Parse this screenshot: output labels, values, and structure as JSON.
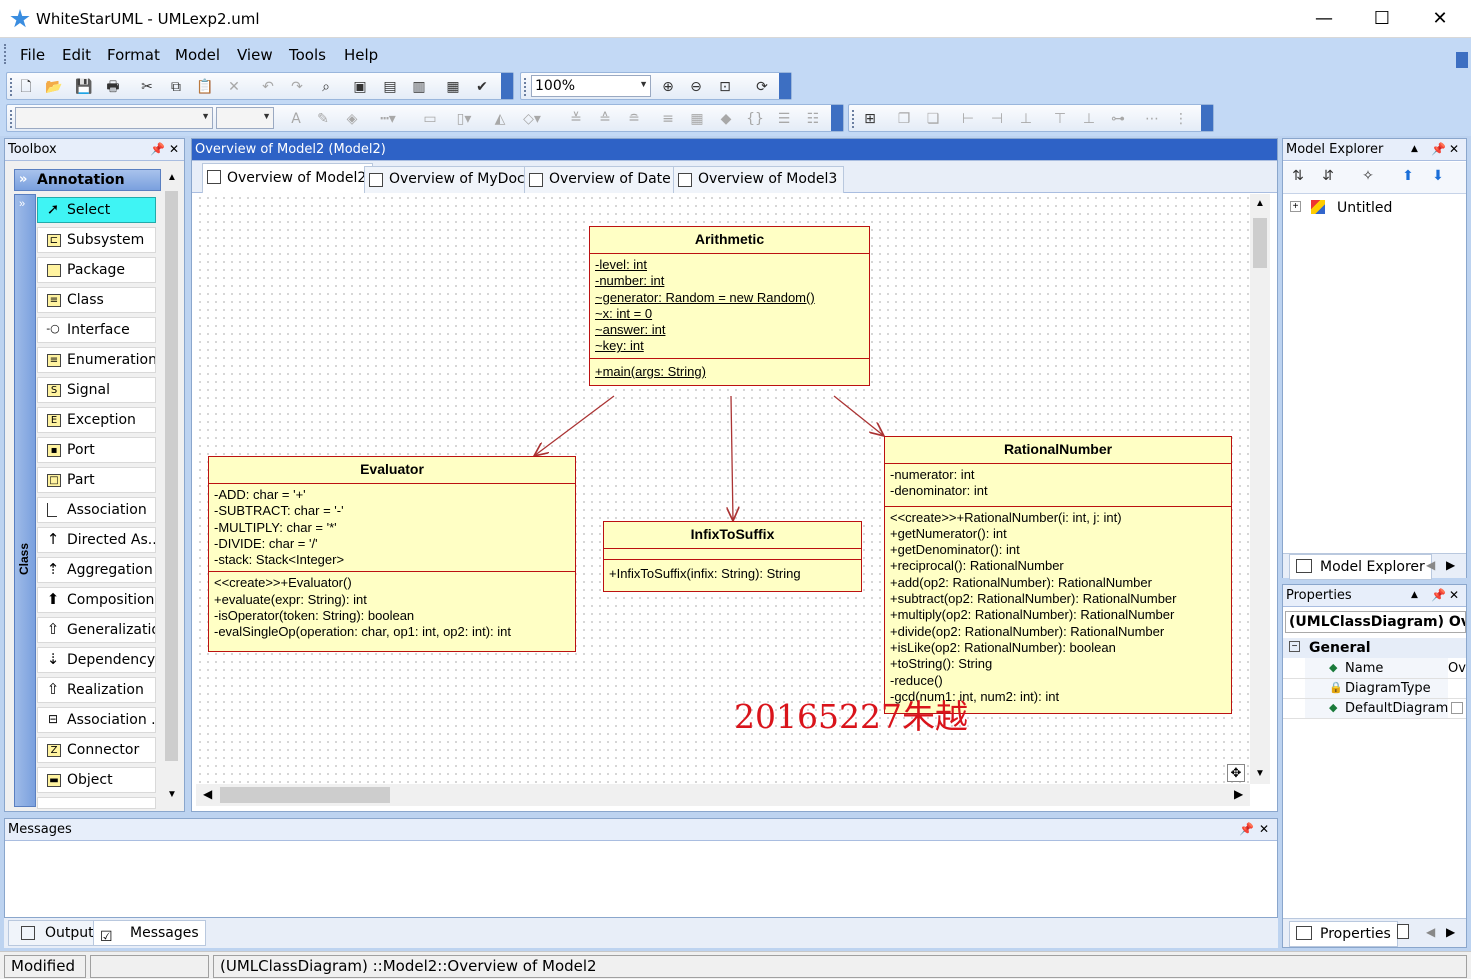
{
  "window": {
    "title": "WhiteStarUML - UMLexp2.uml",
    "minimize": "—",
    "maximize": "☐",
    "close": "✕"
  },
  "menu": [
    "File",
    "Edit",
    "Format",
    "Model",
    "View",
    "Tools",
    "Help"
  ],
  "toolbar": {
    "zoom": "100%"
  },
  "toolbox": {
    "title": "Toolbox",
    "section_annotation": "Annotation",
    "section_class": "Class",
    "tools": [
      "Select",
      "Subsystem",
      "Package",
      "Class",
      "Interface",
      "Enumeration",
      "Signal",
      "Exception",
      "Port",
      "Part",
      "Association",
      "Directed As...",
      "Aggregation",
      "Composition",
      "Generalization",
      "Dependency",
      "Realization",
      "Association ...",
      "Connector",
      "Object"
    ]
  },
  "diagram_window": {
    "title": "Overview of Model2 (Model2)",
    "tabs": [
      "Overview of Model2",
      "Overview of MyDoc",
      "Overview of Date",
      "Overview of Model3"
    ]
  },
  "classes": {
    "arithmetic": {
      "name": "Arithmetic",
      "attributes": [
        "-level: int",
        "-number: int",
        "~generator: Random = new Random()",
        "~x: int = 0",
        "~answer: int",
        "~key: int"
      ],
      "operations": [
        "+main(args: String)"
      ]
    },
    "evaluator": {
      "name": "Evaluator",
      "attributes": [
        "-ADD: char = '+'",
        "-SUBTRACT: char = '-'",
        "-MULTIPLY: char = '*'",
        "-DIVIDE: char = '/'",
        "-stack: Stack<Integer>"
      ],
      "operations": [
        "<<create>>+Evaluator()",
        "+evaluate(expr: String): int",
        "-isOperator(token: String): boolean",
        "-evalSingleOp(operation: char, op1: int, op2: int): int"
      ]
    },
    "infix": {
      "name": "InfixToSuffix",
      "operations": [
        "+InfixToSuffix(infix: String): String"
      ]
    },
    "rational": {
      "name": "RationalNumber",
      "attributes": [
        "-numerator: int",
        "-denominator: int"
      ],
      "operations": [
        "<<create>>+RationalNumber(i: int, j: int)",
        "+getNumerator(): int",
        "+getDenominator(): int",
        "+reciprocal(): RationalNumber",
        "+add(op2: RationalNumber): RationalNumber",
        "+subtract(op2: RationalNumber): RationalNumber",
        "+multiply(op2: RationalNumber): RationalNumber",
        "+divide(op2: RationalNumber): RationalNumber",
        "+isLike(op2: RationalNumber): boolean",
        "+toString(): String",
        "-reduce()",
        "-gcd(num1: int, num2: int): int"
      ]
    }
  },
  "watermark": "20165227朱越",
  "explorer": {
    "title": "Model Explorer",
    "root": "Untitled",
    "tab": "Model Explorer"
  },
  "properties": {
    "title": "Properties",
    "header": "(UMLClassDiagram) Overv",
    "group": "General",
    "rows": [
      {
        "name": "Name",
        "value": "Ov"
      },
      {
        "name": "DiagramType",
        "value": ""
      },
      {
        "name": "DefaultDiagram",
        "value": ""
      }
    ],
    "tab": "Properties"
  },
  "messages": {
    "title": "Messages",
    "tab_output": "Output",
    "tab_messages": "Messages"
  },
  "status": {
    "state": "Modified",
    "path": "(UMLClassDiagram) ::Model2::Overview of Model2"
  },
  "colors": {
    "class_fill": "#ffffc5",
    "class_border": "#b11111",
    "selected_tool": "#3ff4f4",
    "panel_active": "#2e62c6"
  }
}
